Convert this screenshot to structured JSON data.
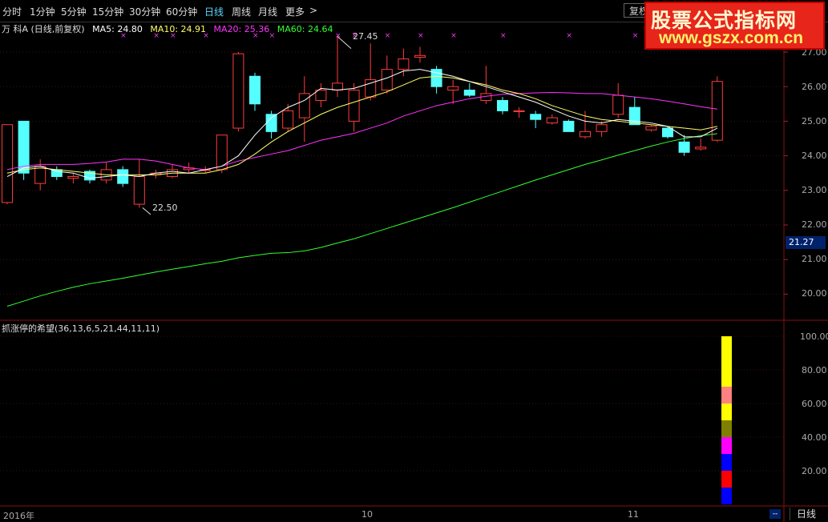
{
  "toolbar": {
    "tabs": [
      "分时",
      "1分钟",
      "5分钟",
      "15分钟",
      "30分钟",
      "60分钟",
      "日线",
      "周线",
      "月线",
      "更多"
    ],
    "active_tab": "日线",
    "more_arrow": ">",
    "search_text": "复权"
  },
  "watermark": {
    "line1": "股票公式指标网",
    "line2": "www.gszx.com.cn"
  },
  "legend": {
    "title": "万 科A (日线,前复权)",
    "ma5": "MA5: 24.80",
    "ma10": "MA10: 24.91",
    "ma20": "MA20: 25.36",
    "ma60": "MA60: 24.64"
  },
  "colors": {
    "up": "#ff3b3b",
    "down": "#54ffff",
    "ma5": "#ffffff",
    "ma10": "#ffff66",
    "ma20": "#ff33ff",
    "ma60": "#33ff33"
  },
  "price_axis": [
    "27.00",
    "26.00",
    "25.00",
    "24.00",
    "23.00",
    "22.00",
    "21.00",
    "20.00"
  ],
  "price_highlight": "21.27",
  "annotations": {
    "high": "27.45",
    "low": "22.50"
  },
  "indicator": {
    "title": "抓涨停的希望(36,13,6,5,21,44,11,11)",
    "axis": [
      "100.00",
      "80.00",
      "60.00",
      "40.00",
      "20.00"
    ]
  },
  "x_labels": {
    "start": "2016年",
    "oct": "10",
    "nov": "11"
  },
  "bottom_tab": "日线",
  "mini_btn": "--",
  "chart_data": {
    "type": "candlestick",
    "ylim": [
      19.5,
      27.3
    ],
    "candles": [
      {
        "o": 22.65,
        "c": 24.9,
        "h": 24.9,
        "l": 22.6
      },
      {
        "o": 25.0,
        "c": 23.5,
        "h": 25.0,
        "l": 23.3
      },
      {
        "o": 23.2,
        "c": 23.7,
        "h": 23.9,
        "l": 23.0
      },
      {
        "o": 23.6,
        "c": 23.4,
        "h": 23.7,
        "l": 23.3
      },
      {
        "o": 23.35,
        "c": 23.4,
        "h": 23.5,
        "l": 23.2
      },
      {
        "o": 23.55,
        "c": 23.3,
        "h": 23.6,
        "l": 23.2
      },
      {
        "o": 23.3,
        "c": 23.6,
        "h": 23.8,
        "l": 23.2
      },
      {
        "o": 23.6,
        "c": 23.2,
        "h": 23.7,
        "l": 23.1
      },
      {
        "o": 22.6,
        "c": 23.4,
        "h": 23.9,
        "l": 22.5
      },
      {
        "o": 23.45,
        "c": 23.5,
        "h": 23.6,
        "l": 23.35
      },
      {
        "o": 23.4,
        "c": 23.6,
        "h": 23.75,
        "l": 23.35
      },
      {
        "o": 23.6,
        "c": 23.65,
        "h": 23.8,
        "l": 23.5
      },
      {
        "o": 23.6,
        "c": 23.6,
        "h": 23.7,
        "l": 23.5
      },
      {
        "o": 23.6,
        "c": 24.6,
        "h": 24.6,
        "l": 23.5
      },
      {
        "o": 24.8,
        "c": 26.95,
        "h": 27.0,
        "l": 24.7
      },
      {
        "o": 26.3,
        "c": 25.5,
        "h": 26.4,
        "l": 25.3
      },
      {
        "o": 25.2,
        "c": 24.7,
        "h": 25.3,
        "l": 24.5
      },
      {
        "o": 24.8,
        "c": 25.3,
        "h": 25.5,
        "l": 24.7
      },
      {
        "o": 25.1,
        "c": 25.8,
        "h": 26.3,
        "l": 24.4
      },
      {
        "o": 25.6,
        "c": 25.9,
        "h": 26.1,
        "l": 25.4
      },
      {
        "o": 25.9,
        "c": 26.1,
        "h": 27.45,
        "l": 25.7
      },
      {
        "o": 25.0,
        "c": 25.9,
        "h": 26.1,
        "l": 24.7
      },
      {
        "o": 25.7,
        "c": 26.2,
        "h": 27.25,
        "l": 25.6
      },
      {
        "o": 25.9,
        "c": 26.5,
        "h": 26.9,
        "l": 25.8
      },
      {
        "o": 26.5,
        "c": 26.8,
        "h": 27.1,
        "l": 26.3
      },
      {
        "o": 26.85,
        "c": 26.9,
        "h": 27.15,
        "l": 26.7
      },
      {
        "o": 26.5,
        "c": 26.0,
        "h": 26.6,
        "l": 25.8
      },
      {
        "o": 25.9,
        "c": 26.0,
        "h": 26.2,
        "l": 25.5
      },
      {
        "o": 25.9,
        "c": 25.75,
        "h": 26.1,
        "l": 25.7
      },
      {
        "o": 25.6,
        "c": 25.8,
        "h": 26.6,
        "l": 25.5
      },
      {
        "o": 25.6,
        "c": 25.3,
        "h": 25.7,
        "l": 25.2
      },
      {
        "o": 25.3,
        "c": 25.3,
        "h": 25.4,
        "l": 25.1
      },
      {
        "o": 25.2,
        "c": 25.05,
        "h": 25.3,
        "l": 24.8
      },
      {
        "o": 24.95,
        "c": 25.1,
        "h": 25.2,
        "l": 24.9
      },
      {
        "o": 25.0,
        "c": 24.7,
        "h": 25.05,
        "l": 24.7
      },
      {
        "o": 24.55,
        "c": 24.7,
        "h": 25.3,
        "l": 24.5
      },
      {
        "o": 24.7,
        "c": 24.9,
        "h": 25.0,
        "l": 24.55
      },
      {
        "o": 25.2,
        "c": 25.75,
        "h": 26.1,
        "l": 25.1
      },
      {
        "o": 25.4,
        "c": 24.9,
        "h": 25.7,
        "l": 24.9
      },
      {
        "o": 24.75,
        "c": 24.85,
        "h": 24.9,
        "l": 24.7
      },
      {
        "o": 24.8,
        "c": 24.55,
        "h": 24.85,
        "l": 24.5
      },
      {
        "o": 24.4,
        "c": 24.1,
        "h": 24.6,
        "l": 24.0
      },
      {
        "o": 24.2,
        "c": 24.25,
        "h": 24.5,
        "l": 24.15
      },
      {
        "o": 24.45,
        "c": 26.15,
        "h": 26.3,
        "l": 24.4
      }
    ],
    "ma5": [
      23.4,
      23.65,
      23.7,
      23.55,
      23.5,
      23.35,
      23.4,
      23.45,
      23.4,
      23.5,
      23.55,
      23.5,
      23.6,
      23.7,
      24.0,
      24.6,
      25.1,
      25.4,
      25.6,
      25.95,
      25.9,
      25.95,
      26.1,
      26.25,
      26.45,
      26.5,
      26.4,
      26.3,
      26.15,
      26.0,
      25.85,
      25.7,
      25.55,
      25.35,
      25.15,
      25.0,
      24.95,
      25.05,
      25.0,
      24.95,
      24.85,
      24.55,
      24.55,
      24.8
    ],
    "ma10": [
      23.5,
      23.6,
      23.65,
      23.6,
      23.55,
      23.5,
      23.45,
      23.45,
      23.45,
      23.45,
      23.5,
      23.5,
      23.5,
      23.6,
      23.75,
      24.05,
      24.4,
      24.7,
      24.95,
      25.2,
      25.4,
      25.55,
      25.7,
      25.85,
      26.05,
      26.25,
      26.3,
      26.25,
      26.15,
      26.05,
      25.9,
      25.8,
      25.65,
      25.45,
      25.3,
      25.15,
      25.05,
      25.0,
      24.95,
      24.9,
      24.85,
      24.8,
      24.75,
      24.85
    ],
    "ma20": [
      23.6,
      23.7,
      23.75,
      23.75,
      23.75,
      23.78,
      23.82,
      23.9,
      23.9,
      23.85,
      23.75,
      23.65,
      23.6,
      23.7,
      23.85,
      23.95,
      24.05,
      24.15,
      24.3,
      24.45,
      24.55,
      24.65,
      24.8,
      24.95,
      25.15,
      25.3,
      25.45,
      25.55,
      25.65,
      25.72,
      25.78,
      25.8,
      25.82,
      25.83,
      25.82,
      25.8,
      25.8,
      25.75,
      25.7,
      25.65,
      25.58,
      25.5,
      25.42,
      25.35
    ],
    "ma60": [
      19.65,
      19.8,
      19.95,
      20.08,
      20.2,
      20.3,
      20.38,
      20.46,
      20.55,
      20.64,
      20.72,
      20.8,
      20.88,
      20.95,
      21.05,
      21.12,
      21.18,
      21.2,
      21.25,
      21.35,
      21.48,
      21.6,
      21.75,
      21.9,
      22.05,
      22.2,
      22.35,
      22.5,
      22.66,
      22.82,
      22.98,
      23.14,
      23.3,
      23.45,
      23.6,
      23.75,
      23.88,
      24.02,
      24.15,
      24.28,
      24.4,
      24.5,
      24.58,
      24.64
    ],
    "markers_at": [
      7,
      9,
      10,
      12,
      15,
      16,
      20,
      21,
      23,
      25,
      27,
      30,
      34,
      38,
      40
    ],
    "indicator_bar": {
      "range": [
        0,
        100
      ],
      "segments": [
        {
          "from": 90,
          "to": 100,
          "color": "#ffff00"
        },
        {
          "from": 80,
          "to": 90,
          "color": "#ffff00"
        },
        {
          "from": 70,
          "to": 80,
          "color": "#ffff00"
        },
        {
          "from": 60,
          "to": 70,
          "color": "#ff8080"
        },
        {
          "from": 50,
          "to": 60,
          "color": "#ffff00"
        },
        {
          "from": 40,
          "to": 50,
          "color": "#808000"
        },
        {
          "from": 30,
          "to": 40,
          "color": "#ff00ff"
        },
        {
          "from": 20,
          "to": 30,
          "color": "#0000ff"
        },
        {
          "from": 10,
          "to": 20,
          "color": "#ff0000"
        },
        {
          "from": 0,
          "to": 10,
          "color": "#0000ff"
        }
      ]
    }
  }
}
